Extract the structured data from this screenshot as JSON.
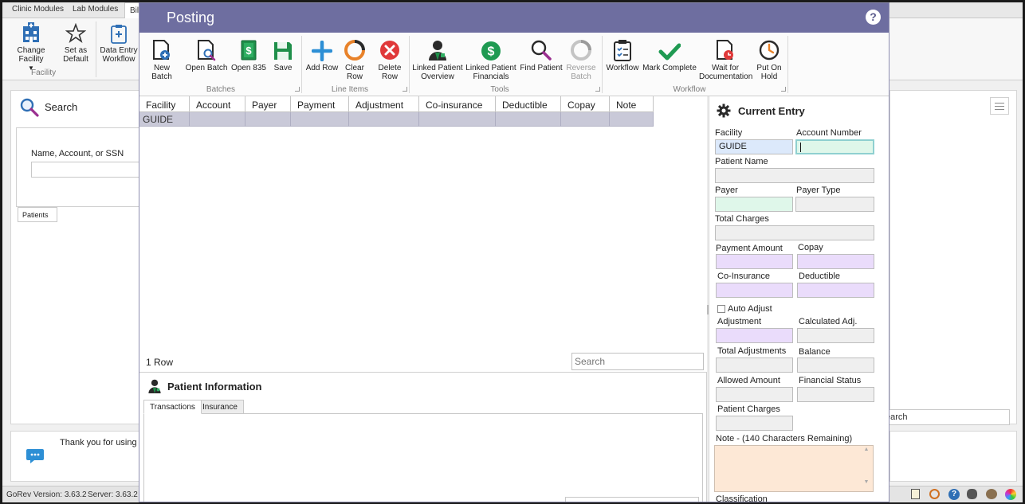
{
  "background_app": {
    "tabs": [
      "Clinic Modules",
      "Lab Modules",
      "Billi"
    ],
    "ribbon": {
      "change_facility": "Change Facility",
      "set_as_default": [
        "Set as",
        "Default"
      ],
      "data_entry_workflow": [
        "Data Entry",
        "Workflow"
      ],
      "facility_group": "Facility"
    },
    "search_title": "Search",
    "search_label": "Name, Account, or SSN",
    "patients_tab": "Patients",
    "thank_you": "Thank you for using",
    "right_search_placeholder": "earch",
    "status": {
      "version": "GoRev Version: 3.63.2",
      "server": "Server: 3.63.2"
    }
  },
  "posting": {
    "title": "Posting",
    "help_label": "?",
    "ribbon": {
      "batches": {
        "label": "Batches",
        "buttons": [
          {
            "label": [
              "New Batch"
            ],
            "icon": "new-batch-icon"
          },
          {
            "label": [
              "Open Batch"
            ],
            "icon": "open-batch-icon"
          },
          {
            "label": [
              "Open 835"
            ],
            "icon": "open-835-icon"
          },
          {
            "label": [
              "Save"
            ],
            "icon": "save-icon"
          }
        ]
      },
      "line_items": {
        "label": "Line Items",
        "buttons": [
          {
            "label": [
              "Add Row"
            ],
            "icon": "plus-icon"
          },
          {
            "label": [
              "Clear",
              "Row"
            ],
            "icon": "clear-row-icon"
          },
          {
            "label": [
              "Delete",
              "Row"
            ],
            "icon": "delete-icon"
          }
        ]
      },
      "tools": {
        "label": "Tools",
        "buttons": [
          {
            "label": [
              "Linked Patient",
              "Overview"
            ],
            "icon": "patient-icon"
          },
          {
            "label": [
              "Linked Patient",
              "Financials"
            ],
            "icon": "dollar-icon"
          },
          {
            "label": [
              "Find Patient"
            ],
            "icon": "find-icon"
          },
          {
            "label": [
              "Reverse",
              "Batch"
            ],
            "icon": "reverse-batch-icon",
            "disabled": true
          }
        ]
      },
      "workflow": {
        "label": "Workflow",
        "buttons": [
          {
            "label": [
              "Workflow"
            ],
            "icon": "workflow-clipboard-icon"
          },
          {
            "label": [
              "Mark Complete"
            ],
            "icon": "checkmark-icon"
          },
          {
            "label": [
              "Wait for",
              "Documentation"
            ],
            "icon": "wait-doc-icon"
          },
          {
            "label": [
              "Put On",
              "Hold"
            ],
            "icon": "clock-icon"
          }
        ]
      }
    },
    "grid": {
      "columns": [
        "Facility",
        "Account",
        "Payer",
        "Payment",
        "Adjustment",
        "Co-insurance",
        "Deductible",
        "Copay",
        "Note"
      ],
      "rows": [
        [
          "GUIDE",
          "",
          "",
          "",
          "",
          "",
          "",
          "",
          ""
        ]
      ],
      "row_count": "1 Row",
      "search_placeholder": "Search"
    },
    "patient_info": {
      "title": "Patient Information",
      "tabs": [
        "Transactions",
        "Insurance"
      ]
    },
    "current_entry": {
      "title": "Current Entry",
      "fields": {
        "facility": {
          "label": "Facility",
          "value": "GUIDE"
        },
        "account_number": {
          "label": "Account Number",
          "value": ""
        },
        "patient_name": {
          "label": "Patient Name",
          "value": ""
        },
        "payer": {
          "label": "Payer",
          "value": ""
        },
        "payer_type": {
          "label": "Payer Type",
          "value": ""
        },
        "total_charges": {
          "label": "Total Charges",
          "value": ""
        },
        "payment_amount": {
          "label": "Payment Amount",
          "value": ""
        },
        "copay": {
          "label": "Copay",
          "value": ""
        },
        "co_insurance": {
          "label": "Co-Insurance",
          "value": ""
        },
        "deductible": {
          "label": "Deductible",
          "value": ""
        },
        "auto_adjust": {
          "label": "Auto Adjust",
          "checked": false
        },
        "adjustment": {
          "label": "Adjustment",
          "value": ""
        },
        "calculated_adj": {
          "label": "Calculated Adj.",
          "value": ""
        },
        "total_adjustments": {
          "label": "Total Adjustments",
          "value": ""
        },
        "balance": {
          "label": "Balance",
          "value": ""
        },
        "allowed_amount": {
          "label": "Allowed Amount",
          "value": ""
        },
        "financial_status": {
          "label": "Financial Status",
          "value": ""
        },
        "patient_charges": {
          "label": "Patient Charges",
          "value": ""
        },
        "note": {
          "label": "Note - (140 Characters Remaining)",
          "value": ""
        },
        "classification": {
          "label": "Classification"
        }
      }
    }
  }
}
